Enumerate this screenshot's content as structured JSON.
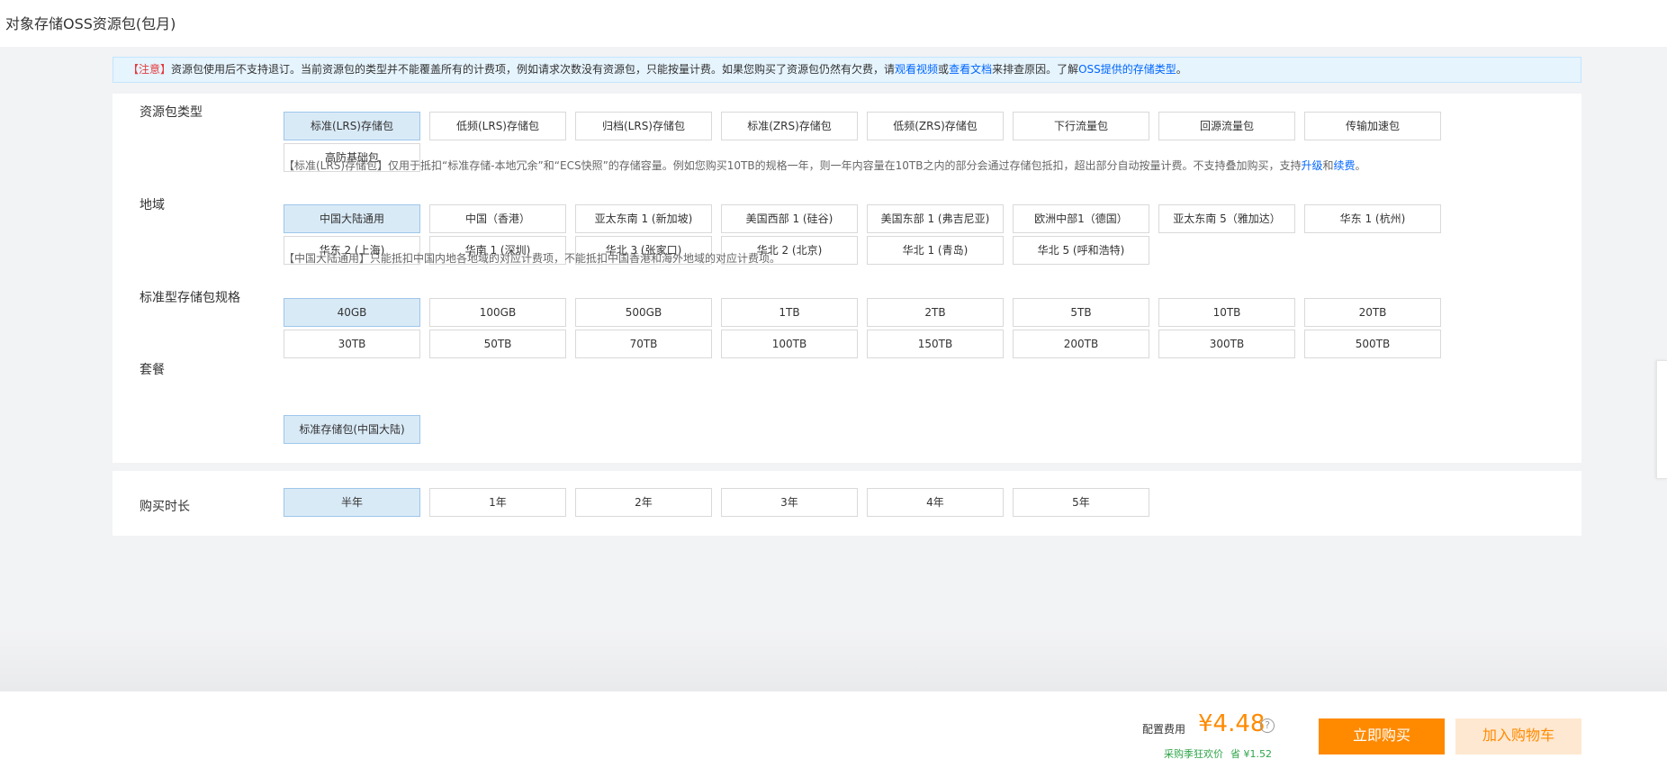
{
  "header": {
    "title": "对象存储OSS资源包(包月)"
  },
  "notice": {
    "warn": "【注意】",
    "text1": "资源包使用后不支持退订。当前资源包的类型并不能覆盖所有的计费项，例如请求次数没有资源包，只能按量计费。如果您购买了资源包仍然有欠费，请",
    "link_video": "观看视频",
    "or": "或",
    "link_docs": "查看文档",
    "text2": "来排查原因。了解",
    "link_types": "OSS提供的存储类型",
    "end": "。"
  },
  "package_type": {
    "label": "资源包类型",
    "options": [
      "标准(LRS)存储包",
      "低频(LRS)存储包",
      "归档(LRS)存储包",
      "标准(ZRS)存储包",
      "低频(ZRS)存储包",
      "下行流量包",
      "回源流量包",
      "传输加速包",
      "高防基础包"
    ],
    "selected_index": 0,
    "hint_text": "【标准(LRS)存储包】仅用于抵扣“标准存储-本地冗余”和“ECS快照”的存储容量。例如您购买10TB的规格一年，则一年内容量在10TB之内的部分会通过存储包抵扣，超出部分自动按量计费。不支持叠加购买，支持",
    "hint_link_upgrade": "升级",
    "hint_and": "和",
    "hint_link_renew": "续费",
    "hint_end": "。"
  },
  "region": {
    "label": "地域",
    "options": [
      "中国大陆通用",
      "中国（香港）",
      "亚太东南 1 (新加坡)",
      "美国西部 1 (硅谷)",
      "美国东部 1 (弗吉尼亚)",
      "欧洲中部1（德国）",
      "亚太东南 5（雅加达）",
      "华东 1 (杭州)",
      "华东 2 (上海)",
      "华南 1 (深圳)",
      "华北 3 (张家口)",
      "华北 2 (北京)",
      "华北 1 (青岛)",
      "华北 5 (呼和浩特)"
    ],
    "selected_index": 0,
    "hint": "【中国大陆通用】只能抵扣中国内地各地域的对应计费项，不能抵扣中国香港和海外地域的对应计费项。"
  },
  "spec": {
    "label": "标准型存储包规格",
    "options": [
      "40GB",
      "100GB",
      "500GB",
      "1TB",
      "2TB",
      "5TB",
      "10TB",
      "20TB",
      "30TB",
      "50TB",
      "70TB",
      "100TB",
      "150TB",
      "200TB",
      "300TB",
      "500TB"
    ],
    "selected_index": 0
  },
  "plan": {
    "label": "套餐",
    "options": [
      "标准存储包(中国大陆)"
    ],
    "selected_index": 0
  },
  "duration": {
    "label": "购买时长",
    "options": [
      "半年",
      "1年",
      "2年",
      "3年",
      "4年",
      "5年"
    ],
    "selected_index": 0
  },
  "footer": {
    "fee_label": "配置费用",
    "price": "¥4.48",
    "help_glyph": "?",
    "promo_label": "采购季狂欢价",
    "promo_save": "省 ¥1.52",
    "buy_label": "立即购买",
    "cart_label": "加入购物车"
  },
  "colors": {
    "accent": "#ff8a00",
    "selected_bg": "#d9eaf7",
    "link": "#0066ff",
    "warning": "#e4393c",
    "promo": "#2fa54a"
  }
}
